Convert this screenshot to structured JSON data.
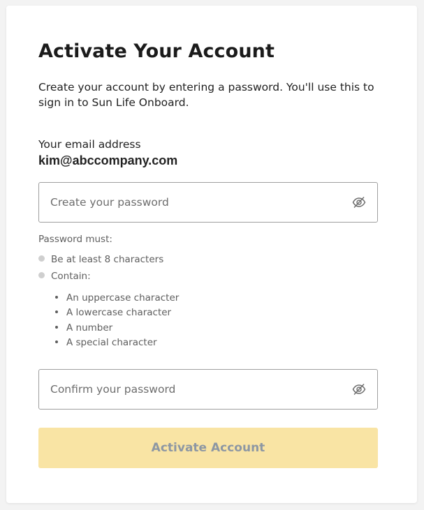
{
  "header": {
    "title": "Activate Your Account",
    "description": "Create your account by entering a password. You'll use this to sign in to Sun Life Onboard."
  },
  "account": {
    "email_label": "Your email address",
    "email_value": "kim@abccompany.com"
  },
  "password_field": {
    "value": "",
    "placeholder": "Create your password",
    "toggle_icon": "eye-slash-icon"
  },
  "requirements": {
    "title": "Password must:",
    "rules": [
      "Be at least 8 characters",
      "Contain:"
    ],
    "contain_items": [
      "An uppercase character",
      "A lowercase character",
      "A number",
      "A special character"
    ]
  },
  "confirm_field": {
    "value": "",
    "placeholder": "Confirm your password",
    "toggle_icon": "eye-slash-icon"
  },
  "actions": {
    "activate_label": "Activate Account"
  },
  "colors": {
    "button_background": "#f9e4a4",
    "button_text": "#8d97a3",
    "requirement_dot": "#cfcfcf"
  }
}
